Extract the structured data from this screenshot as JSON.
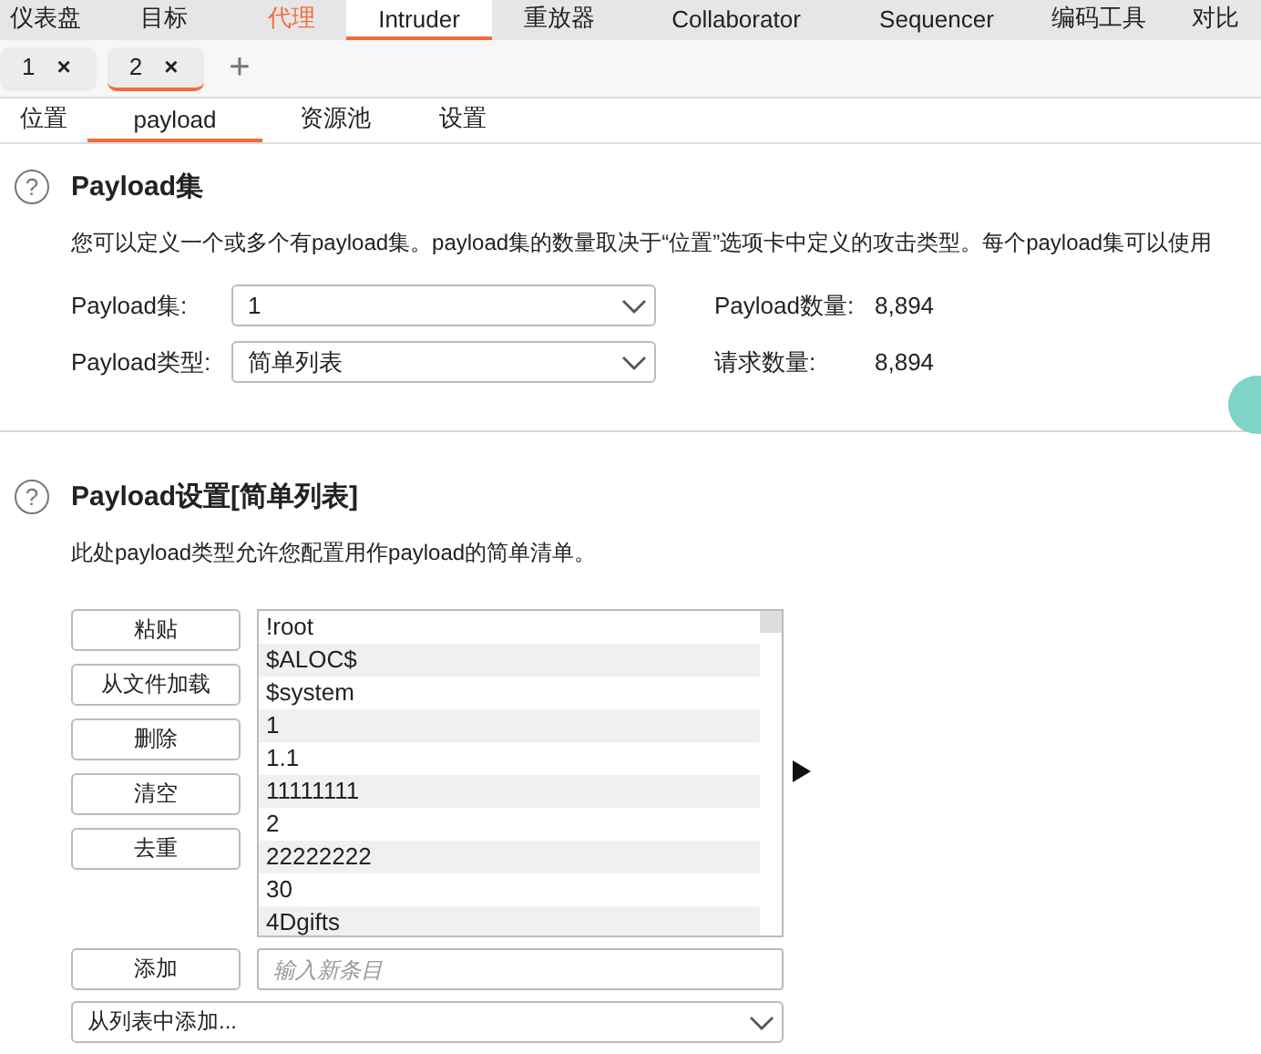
{
  "main_tabs": [
    {
      "label": "仪表盘",
      "selected": false,
      "highlighted": false
    },
    {
      "label": "目标",
      "selected": false,
      "highlighted": false
    },
    {
      "label": "代理",
      "selected": false,
      "highlighted": true
    },
    {
      "label": "Intruder",
      "selected": true,
      "highlighted": false
    },
    {
      "label": "重放器",
      "selected": false,
      "highlighted": false
    },
    {
      "label": "Collaborator",
      "selected": false,
      "highlighted": false
    },
    {
      "label": "Sequencer",
      "selected": false,
      "highlighted": false
    },
    {
      "label": "编码工具",
      "selected": false,
      "highlighted": false
    },
    {
      "label": "对比",
      "selected": false,
      "highlighted": false
    }
  ],
  "attack_tabs": [
    {
      "label": "1",
      "close": "×",
      "selected": false
    },
    {
      "label": "2",
      "close": "×",
      "selected": true
    }
  ],
  "add_tab": "+",
  "sub_tabs": [
    {
      "label": "位置",
      "selected": false
    },
    {
      "label": "payload",
      "selected": true
    },
    {
      "label": "资源池",
      "selected": false
    },
    {
      "label": "设置",
      "selected": false
    }
  ],
  "payload_sets": {
    "help": "?",
    "title": "Payload集",
    "description": "您可以定义一个或多个有payload集。payload集的数量取决于“位置”选项卡中定义的攻击类型。每个payload集可以使用",
    "rows": [
      {
        "label": "Payload集:",
        "value": "1",
        "stat_label": "Payload数量:",
        "stat_value": "8,894"
      },
      {
        "label": "Payload类型:",
        "value": "简单列表",
        "stat_label": "请求数量:",
        "stat_value": "8,894"
      }
    ]
  },
  "payload_settings": {
    "help": "?",
    "title": "Payload设置[简单列表]",
    "description": "此处payload类型允许您配置用作payload的简单清单。",
    "buttons": [
      "粘贴",
      "从文件加载",
      "删除",
      "清空",
      "去重"
    ],
    "items": [
      "!root",
      "$ALOC$",
      "$system",
      "1",
      "1.1",
      "11111111",
      "2",
      "22222222",
      "30",
      "4Dgifts"
    ],
    "add_button": "添加",
    "new_item_placeholder": "输入新条目",
    "add_from_list": "从列表中添加..."
  }
}
